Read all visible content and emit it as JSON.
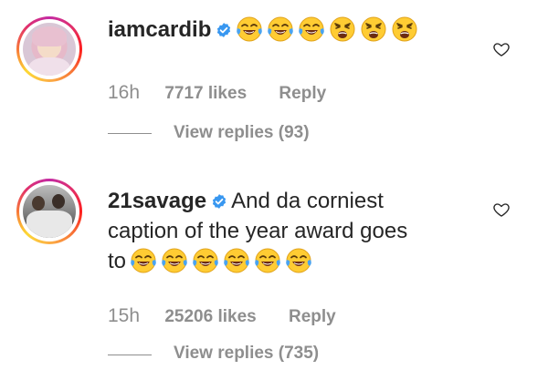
{
  "comments": [
    {
      "username": "iamcardib",
      "verified": true,
      "text": "",
      "emojis": [
        "face-with-tears-of-joy",
        "face-with-tears-of-joy",
        "face-with-tears-of-joy",
        "weary-face",
        "weary-face",
        "weary-face"
      ],
      "time": "16h",
      "likes": "7717 likes",
      "reply_label": "Reply",
      "view_replies": "View replies (93)"
    },
    {
      "username": "21savage",
      "verified": true,
      "text_line1": "And da corniest",
      "text_line2": "caption of the year award goes",
      "text_line3": "to",
      "emojis": [
        "face-with-tears-of-joy",
        "face-with-tears-of-joy",
        "face-with-tears-of-joy",
        "face-with-tears-of-joy",
        "face-with-tears-of-joy",
        "face-with-tears-of-joy"
      ],
      "time": "15h",
      "likes": "25206 likes",
      "reply_label": "Reply",
      "view_replies": "View replies (735)"
    }
  ],
  "colors": {
    "verified_blue": "#3897f0",
    "muted_gray": "#8e8e8e",
    "text": "#262626"
  },
  "icons": {
    "like": "heart-outline-icon",
    "verified": "verified-badge-icon"
  }
}
